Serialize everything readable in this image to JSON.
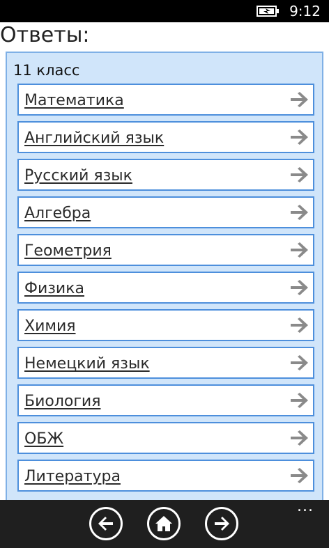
{
  "status_bar": {
    "time": "9:12",
    "battery_icon": "battery-charging-icon"
  },
  "header": {
    "title": "Ответы:"
  },
  "panel": {
    "heading": "11 класс",
    "items": [
      {
        "label": "Математика"
      },
      {
        "label": "Английский язык"
      },
      {
        "label": "Русский язык"
      },
      {
        "label": "Алгебра"
      },
      {
        "label": "Геометрия"
      },
      {
        "label": "Физика"
      },
      {
        "label": "Химия"
      },
      {
        "label": "Немецкий язык"
      },
      {
        "label": "Биология"
      },
      {
        "label": "ОБЖ"
      },
      {
        "label": "Литература"
      }
    ]
  },
  "app_bar": {
    "more_label": "...",
    "buttons": [
      "back-arrow-icon",
      "home-icon",
      "forward-arrow-icon"
    ]
  },
  "colors": {
    "panel_bg": "#d0e5fa",
    "panel_border": "#7fb0e6",
    "item_border": "#4d8fdc",
    "arrow": "#8a8a8a",
    "app_bar_bg": "#1f1f1f"
  }
}
